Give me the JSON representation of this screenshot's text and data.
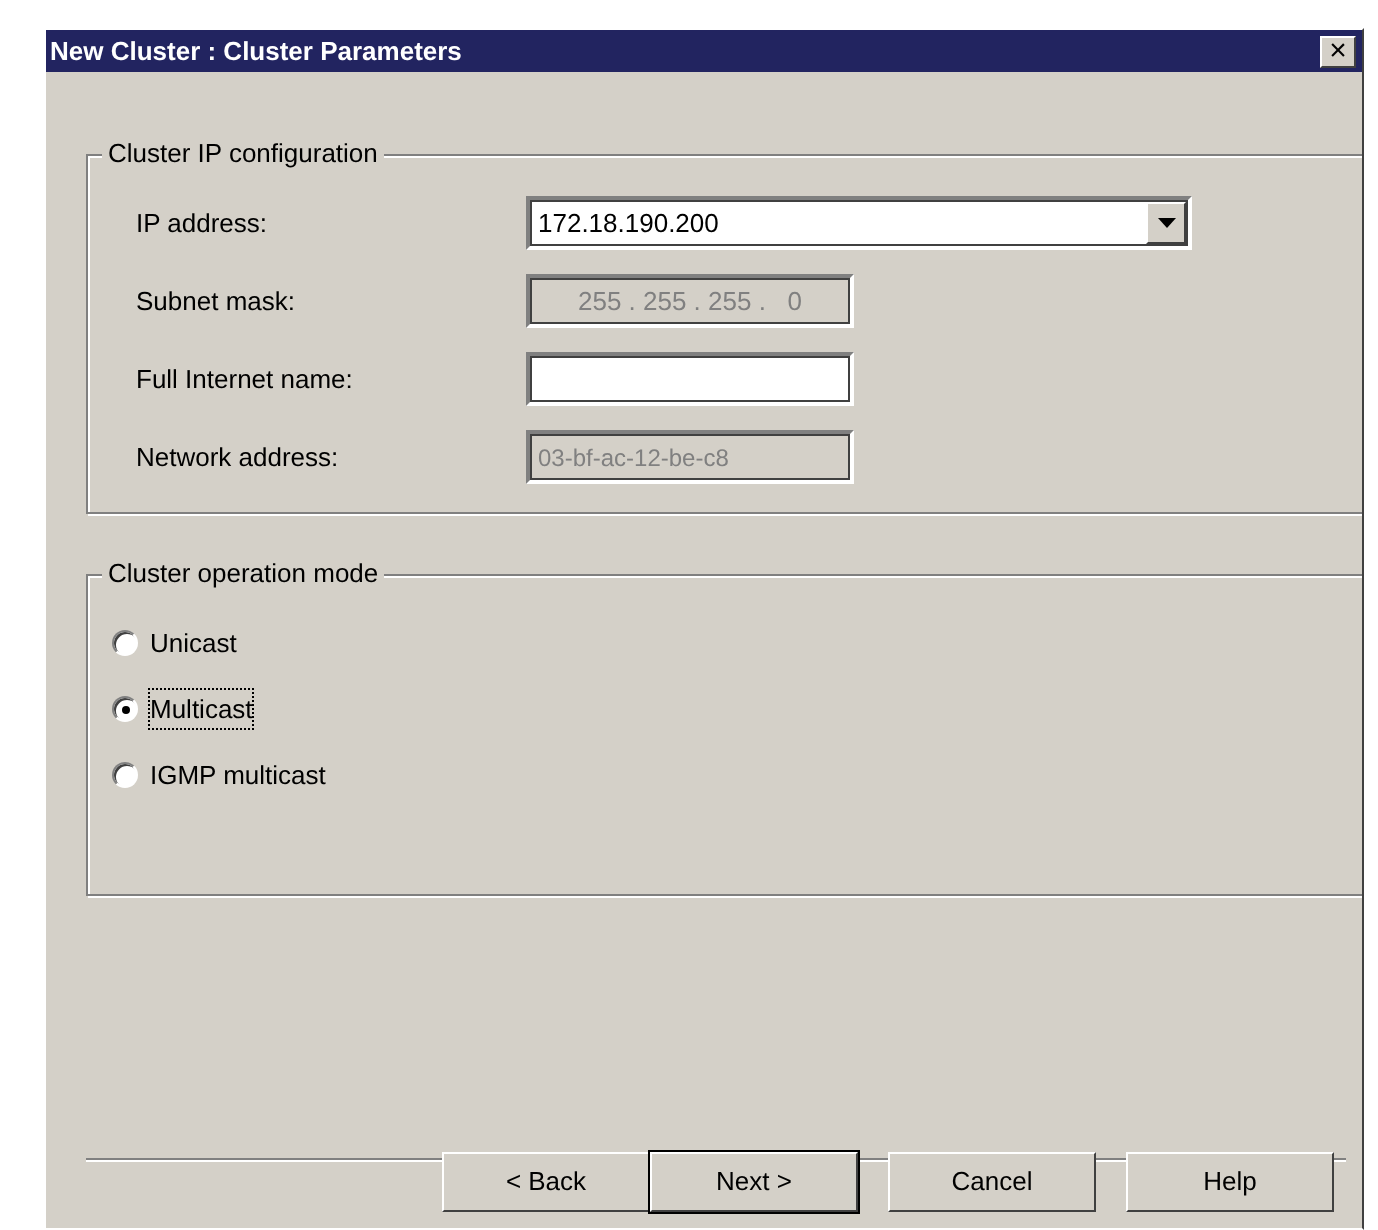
{
  "window": {
    "title": "New Cluster :  Cluster Parameters",
    "close": "×"
  },
  "ip_group": {
    "title": "Cluster IP configuration",
    "fields": [
      {
        "label": "IP address:",
        "kind": "combo",
        "value": "172.18.190.200",
        "disabled": false
      },
      {
        "label": "Subnet mask:",
        "kind": "ip",
        "value": "255 . 255 . 255 .   0",
        "disabled": true
      },
      {
        "label": "Full Internet name:",
        "kind": "text",
        "disabled": false
      },
      {
        "label": "Network address:",
        "kind": "text",
        "value": "03-bf-ac-12-be-c8",
        "disabled": true
      }
    ]
  },
  "mode_group": {
    "title": "Cluster operation mode",
    "options": [
      {
        "label": "Unicast",
        "selected": false
      },
      {
        "label": "Multicast",
        "selected": true
      },
      {
        "label": "IGMP multicast",
        "selected": false
      }
    ]
  },
  "buttons": [
    {
      "label": "< Back",
      "default": false
    },
    {
      "label": "Next >",
      "default": true
    },
    {
      "label": "Cancel",
      "default": false
    },
    {
      "label": "Help",
      "default": false
    }
  ]
}
